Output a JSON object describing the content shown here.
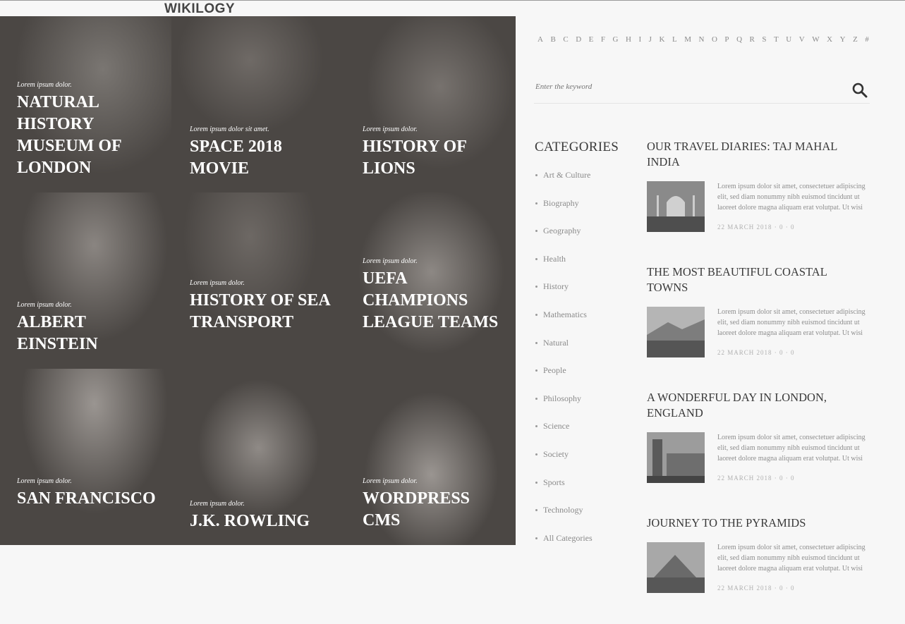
{
  "site": {
    "logo": "WIKILOGY"
  },
  "grid": [
    {
      "subtitle": "Lorem ipsum dolor.",
      "title": "NATURAL HISTORY MUSEUM OF LONDON"
    },
    {
      "subtitle": "Lorem ipsum dolor sit amet.",
      "title": "SPACE 2018 MOVIE"
    },
    {
      "subtitle": "Lorem ipsum dolor.",
      "title": "HISTORY OF LIONS"
    },
    {
      "subtitle": "Lorem ipsum dolor.",
      "title": "ALBERT EINSTEIN"
    },
    {
      "subtitle": "Lorem ipsum dolor.",
      "title": "HISTORY OF SEA TRANSPORT"
    },
    {
      "subtitle": "Lorem ipsum dolor.",
      "title": "UEFA CHAMPIONS LEAGUE TEAMS"
    },
    {
      "subtitle": "Lorem ipsum dolor.",
      "title": "SAN FRANCISCO"
    },
    {
      "subtitle": "Lorem ipsum dolor.",
      "title": "J.K. ROWLING"
    },
    {
      "subtitle": "Lorem ipsum dolor.",
      "title": "WORDPRESS CMS"
    }
  ],
  "alphabet": [
    "A",
    "B",
    "C",
    "D",
    "E",
    "F",
    "G",
    "H",
    "I",
    "J",
    "K",
    "L",
    "M",
    "N",
    "O",
    "P",
    "Q",
    "R",
    "S",
    "T",
    "U",
    "V",
    "W",
    "X",
    "Y",
    "Z",
    "#"
  ],
  "search": {
    "placeholder": "Enter the keyword"
  },
  "categories": {
    "heading": "CATEGORIES",
    "items": [
      "Art & Culture",
      "Biography",
      "Geography",
      "Health",
      "History",
      "Mathematics",
      "Natural",
      "People",
      "Philosophy",
      "Science",
      "Society",
      "Sports",
      "Technology",
      "All Categories"
    ]
  },
  "posts": [
    {
      "title": "OUR TRAVEL DIARIES: TAJ MAHAL INDIA",
      "excerpt": "Lorem ipsum dolor sit amet, consectetuer adipiscing elit, sed diam nonummy nibh euismod tincidunt ut laoreet dolore magna aliquam erat volutpat. Ut wisi",
      "meta": "22 MARCH 2018 · 0 · 0"
    },
    {
      "title": "THE MOST BEAUTIFUL COASTAL TOWNS",
      "excerpt": "Lorem ipsum dolor sit amet, consectetuer adipiscing elit, sed diam nonummy nibh euismod tincidunt ut laoreet dolore magna aliquam erat volutpat. Ut wisi",
      "meta": "22 MARCH 2018 · 0 · 0"
    },
    {
      "title": "A WONDERFUL DAY IN LONDON, ENGLAND",
      "excerpt": "Lorem ipsum dolor sit amet, consectetuer adipiscing elit, sed diam nonummy nibh euismod tincidunt ut laoreet dolore magna aliquam erat volutpat. Ut wisi",
      "meta": "22 MARCH 2018 · 0 · 0"
    },
    {
      "title": "JOURNEY TO THE PYRAMIDS",
      "excerpt": "Lorem ipsum dolor sit amet, consectetuer adipiscing elit, sed diam nonummy nibh euismod tincidunt ut laoreet dolore magna aliquam erat volutpat. Ut wisi",
      "meta": "22 MARCH 2018 · 0 · 0"
    }
  ]
}
